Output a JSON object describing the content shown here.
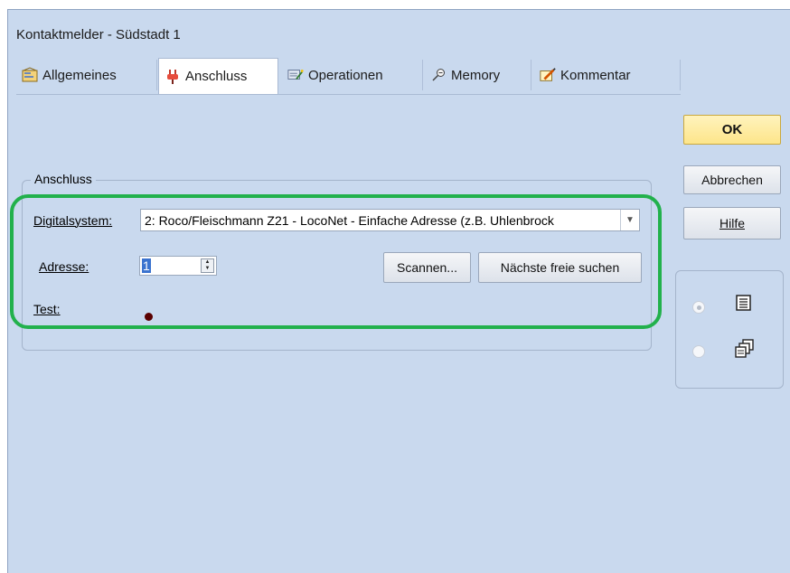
{
  "window": {
    "title": "Kontaktmelder - Südstadt 1"
  },
  "tabs": [
    {
      "label": "Allgemeines",
      "icon": "properties-icon"
    },
    {
      "label": "Anschluss",
      "icon": "plug-icon",
      "active": true
    },
    {
      "label": "Operationen",
      "icon": "operations-icon"
    },
    {
      "label": "Memory",
      "icon": "memory-pin-icon"
    },
    {
      "label": "Kommentar",
      "icon": "comment-pencil-icon"
    }
  ],
  "buttons": {
    "ok": "OK",
    "cancel": "Abbrechen",
    "help": "Hilfe"
  },
  "connection": {
    "group_label": "Anschluss",
    "digital_system_label": "Digitalsystem:",
    "digital_system_value": "2: Roco/Fleischmann Z21 - LocoNet - Einfache Adresse (z.B. Uhlenbrock",
    "address_label": "Adresse:",
    "address_value": "1",
    "scan_button": "Scannen...",
    "next_free_button": "Nächste freie suchen",
    "test_label": "Test:"
  },
  "colors": {
    "dialog_background": "#c9d9ee",
    "highlight_frame": "#22b14c",
    "ok_button": "#fde58a",
    "test_led": "#5a0000"
  },
  "view_mode": {
    "selected": "list"
  }
}
